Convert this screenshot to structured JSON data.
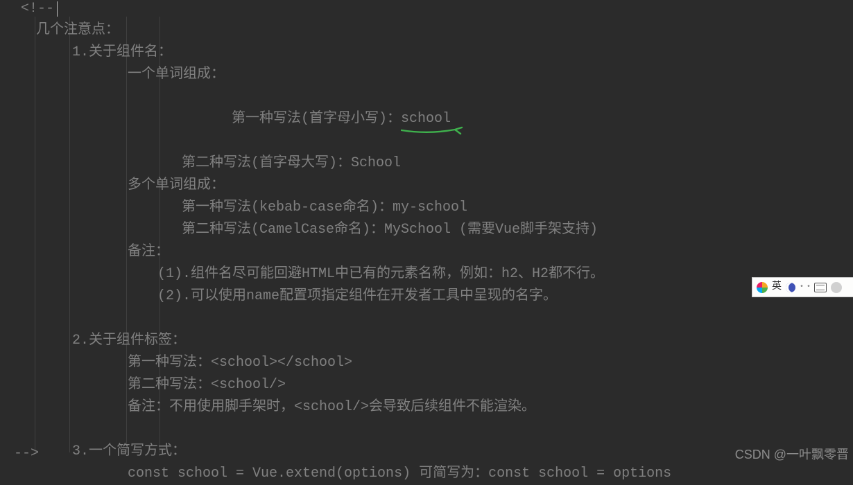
{
  "comment_open": "<!--",
  "comment_close": "-->",
  "content": {
    "heading": "几个注意点：",
    "s1": {
      "title": "1.关于组件名：",
      "single": {
        "title": "一个单词组成：",
        "m1_label": "第一种写法(首字母小写)：",
        "m1_value": "school",
        "m2": "第二种写法(首字母大写)：School"
      },
      "multi": {
        "title": "多个单词组成：",
        "m1": "第一种写法(kebab-case命名)：my-school",
        "m2": "第二种写法(CamelCase命名)：MySchool (需要Vue脚手架支持)"
      },
      "note": {
        "title": "备注：",
        "n1": "(1).组件名尽可能回避HTML中已有的元素名称，例如：h2、H2都不行。",
        "n2": "(2).可以使用name配置项指定组件在开发者工具中呈现的名字。"
      }
    },
    "s2": {
      "title": "2.关于组件标签：",
      "m1": "第一种写法：<school></school>",
      "m2": "第二种写法：<school/>",
      "note": "备注：不用使用脚手架时，<school/>会导致后续组件不能渲染。"
    },
    "s3": {
      "title": "3.一个简写方式：",
      "body": "const school = Vue.extend(options) 可简写为：const school = options"
    }
  },
  "ime_label": "英",
  "csdn_watermark": "CSDN @一叶飘零晋"
}
